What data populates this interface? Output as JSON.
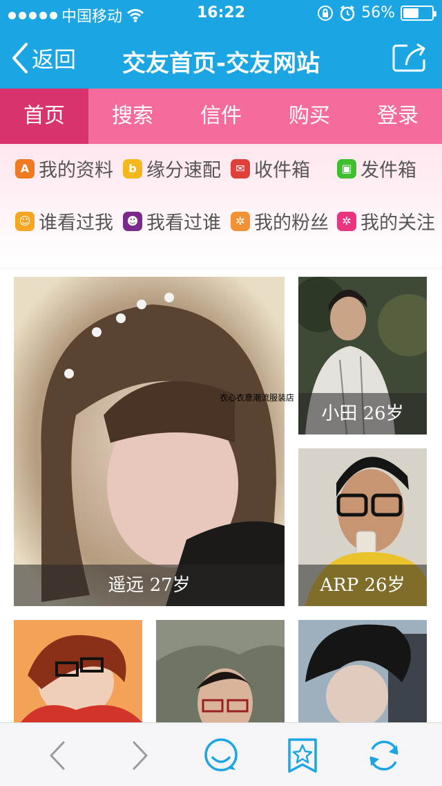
{
  "status_bar": {
    "carrier": "中国移动",
    "time": "16:22",
    "battery_percent": "56%",
    "battery_level": 0.56,
    "icons": [
      "signal-dots-icon",
      "wifi-icon",
      "orientation-lock-icon",
      "alarm-icon",
      "battery-icon"
    ]
  },
  "nav": {
    "back_label": "返回",
    "title": "交友首页-交友网站",
    "share_icon": "share-icon"
  },
  "tabs": [
    {
      "label": "首页",
      "active": true
    },
    {
      "label": "搜索",
      "active": false
    },
    {
      "label": "信件",
      "active": false
    },
    {
      "label": "购买",
      "active": false
    },
    {
      "label": "登录",
      "active": false
    }
  ],
  "quick_menu": [
    {
      "label": "我的资料",
      "icon": "profile-icon",
      "color": "#f07a22"
    },
    {
      "label": "缘分速配",
      "icon": "match-icon",
      "color": "#f5b81c"
    },
    {
      "label": "收件箱",
      "icon": "inbox-icon",
      "color": "#e0403a"
    },
    {
      "label": "发件箱",
      "icon": "outbox-icon",
      "color": "#3fbf2f"
    },
    {
      "label": "谁看过我",
      "icon": "viewed-me-icon",
      "color": "#f5a623"
    },
    {
      "label": "我看过谁",
      "icon": "i-viewed-icon",
      "color": "#7b2a8c"
    },
    {
      "label": "我的粉丝",
      "icon": "fans-icon",
      "color": "#f39234"
    },
    {
      "label": "我的关注",
      "icon": "following-icon",
      "color": "#e8357e"
    }
  ],
  "profiles": [
    {
      "caption": "遥远 27岁"
    },
    {
      "caption": "小田 26岁"
    },
    {
      "caption": "ARP 26岁"
    },
    {
      "caption": ""
    },
    {
      "caption": ""
    },
    {
      "caption": ""
    }
  ],
  "watermark": "衣心衣意潮流服装店",
  "toolbar": {
    "icons": [
      "back-arrow-icon",
      "forward-arrow-icon",
      "chat-icon",
      "bookmark-star-icon",
      "refresh-icon"
    ]
  },
  "colors": {
    "nav_blue": "#1ba6e3",
    "tab_pink": "#f46b9c",
    "tab_active": "#d9336d",
    "toolbar_icon": "#1ba6e3"
  }
}
